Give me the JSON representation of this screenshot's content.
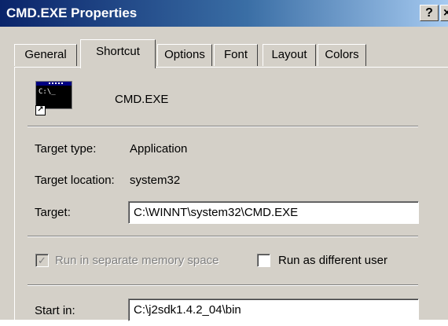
{
  "window": {
    "title": "CMD.EXE Properties",
    "help_label": "?",
    "close_label": "×"
  },
  "tabs": [
    {
      "label": "General",
      "active": false
    },
    {
      "label": "Shortcut",
      "active": true
    },
    {
      "label": "Options",
      "active": false
    },
    {
      "label": "Font",
      "active": false
    },
    {
      "label": "Layout",
      "active": false
    },
    {
      "label": "Colors",
      "active": false
    }
  ],
  "shortcut": {
    "icon_text": "C:\\_",
    "name": "CMD.EXE",
    "target_type_label": "Target type:",
    "target_type_value": "Application",
    "target_location_label": "Target location:",
    "target_location_value": "system32",
    "target_label": "Target:",
    "target_value": "C:\\WINNT\\system32\\CMD.EXE",
    "run_separate_label": "Run in separate memory space",
    "run_separate_checked": true,
    "run_separate_enabled": false,
    "run_as_label": "Run as different user",
    "run_as_checked": false,
    "start_in_label": "Start in:",
    "start_in_value": "C:\\j2sdk1.4.2_04\\bin"
  }
}
